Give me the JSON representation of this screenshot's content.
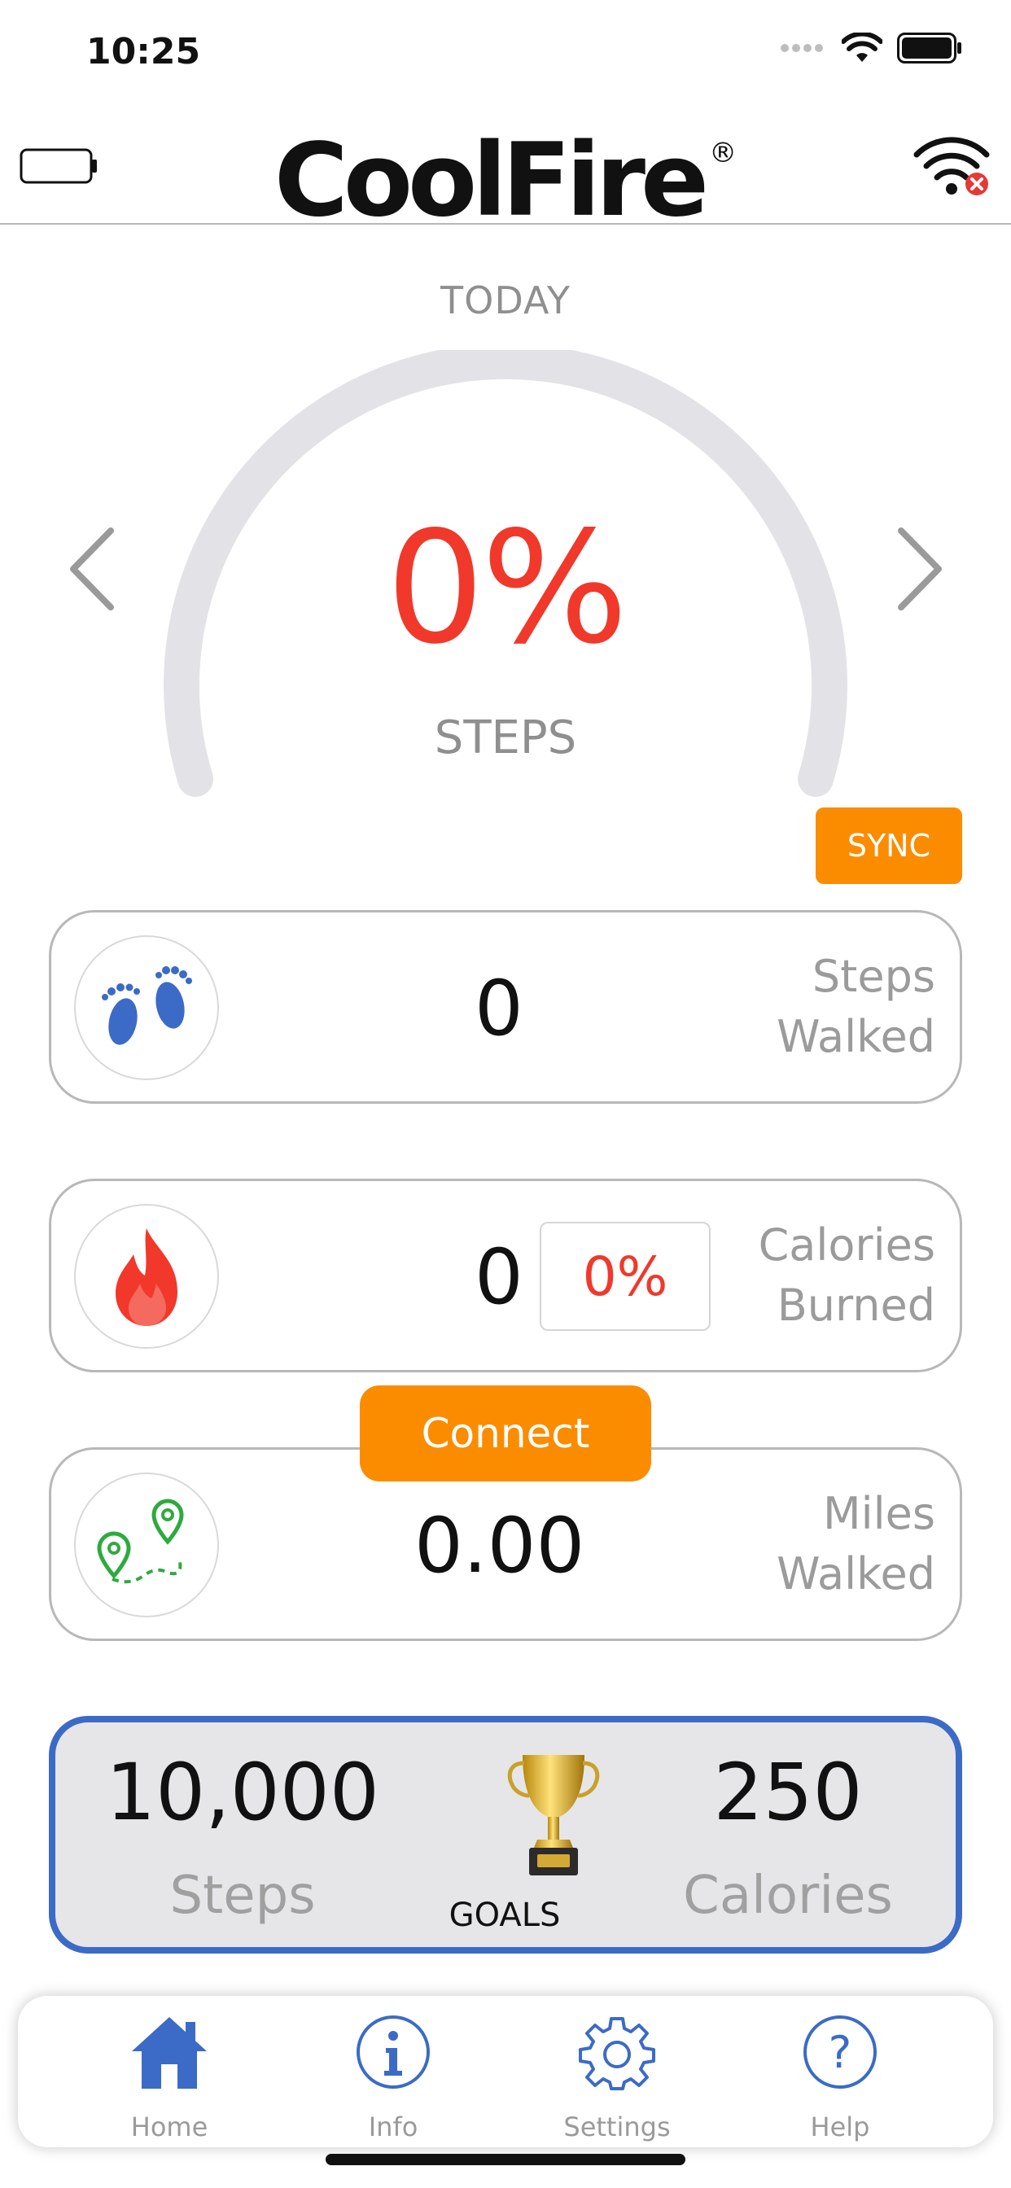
{
  "status_bar": {
    "time": "10:25"
  },
  "header": {
    "logo_text": "CoolFire",
    "logo_mark": "®"
  },
  "today": {
    "label": "TODAY",
    "percent_text": "0%",
    "percent_value": 0,
    "metric_label": "STEPS",
    "sync_label": "SYNC"
  },
  "cards": {
    "steps": {
      "value": "0",
      "label_line1": "Steps",
      "label_line2": "Walked",
      "icon": "footprints-icon"
    },
    "calories": {
      "value": "0",
      "percent": "0%",
      "label_line1": "Calories",
      "label_line2": "Burned",
      "icon": "flame-icon"
    },
    "miles": {
      "value": "0.00",
      "label_line1": "Miles",
      "label_line2": "Walked",
      "icon": "route-pins-icon"
    }
  },
  "connect_label": "Connect",
  "goals": {
    "title": "GOALS",
    "steps_value": "10,000",
    "steps_label": "Steps",
    "calories_value": "250",
    "calories_label": "Calories",
    "icon": "trophy-icon"
  },
  "tabs": [
    {
      "label": "Home",
      "icon": "home-icon",
      "active": true
    },
    {
      "label": "Info",
      "icon": "info-icon",
      "active": false
    },
    {
      "label": "Settings",
      "icon": "gear-icon",
      "active": false
    },
    {
      "label": "Help",
      "icon": "help-icon",
      "active": false
    }
  ],
  "colors": {
    "accent_orange": "#fb8c00",
    "accent_red": "#f0392b",
    "accent_blue": "#3b6bc6",
    "icon_green": "#2eaa3e"
  }
}
